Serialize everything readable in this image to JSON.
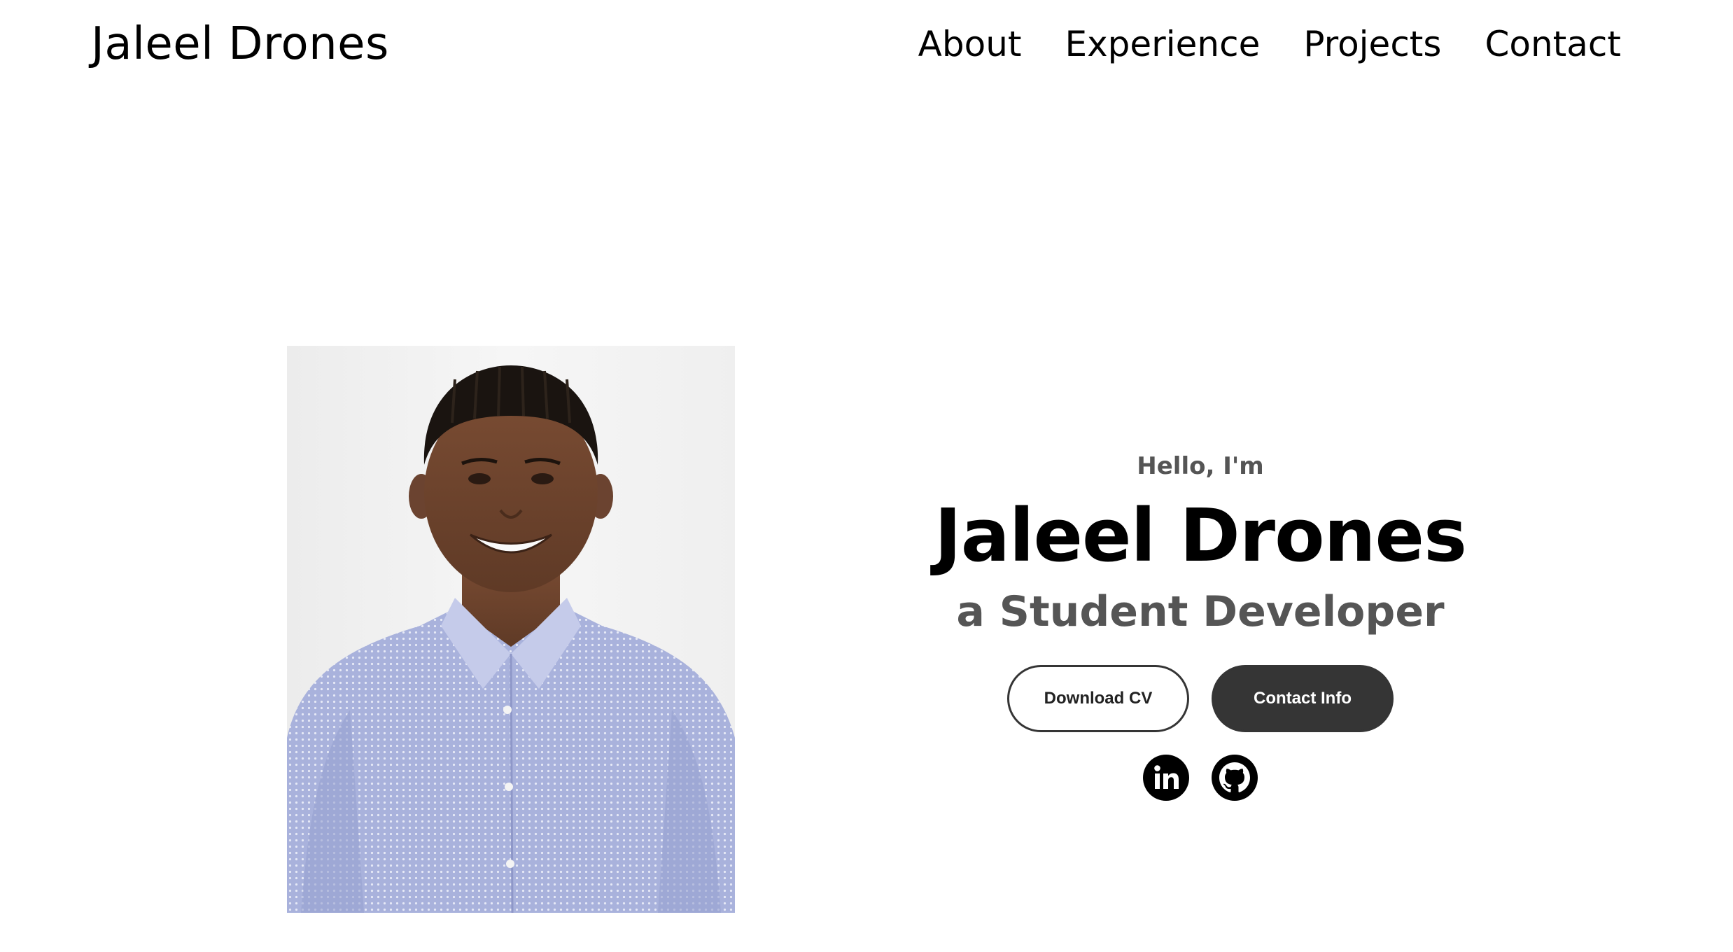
{
  "nav": {
    "logo": "Jaleel Drones",
    "links": [
      {
        "label": "About"
      },
      {
        "label": "Experience"
      },
      {
        "label": "Projects"
      },
      {
        "label": "Contact"
      }
    ]
  },
  "hero": {
    "greeting": "Hello, I'm",
    "name": "Jaleel Drones",
    "subtitle": "a Student Developer",
    "buttons": {
      "download_cv": "Download CV",
      "contact_info": "Contact Info"
    },
    "socials": [
      {
        "icon": "linkedin-icon"
      },
      {
        "icon": "github-icon"
      }
    ]
  },
  "colors": {
    "text": "#000000",
    "muted": "#555555",
    "button_dark": "#353535",
    "background": "#ffffff"
  }
}
